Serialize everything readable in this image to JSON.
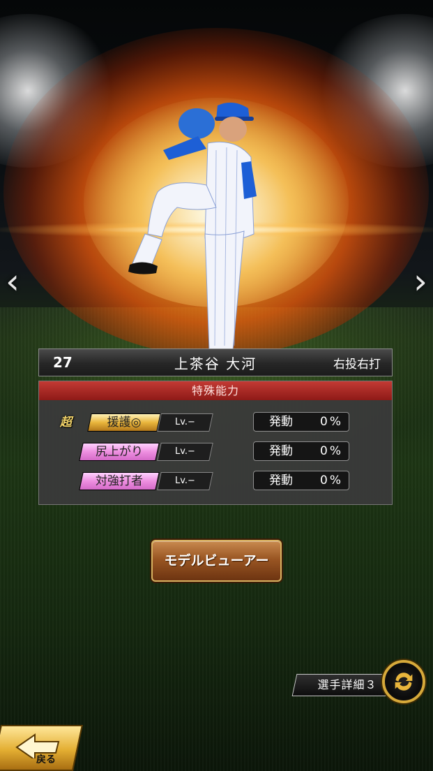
{
  "player": {
    "number": "27",
    "name": "上茶谷 大河",
    "position": "右投右打"
  },
  "abilities": {
    "header": "特殊能力",
    "items": [
      {
        "prefix": "超",
        "name": "援護◎",
        "level": "Lv.−",
        "status_label": "発動",
        "status_value": "0%",
        "color": "#e9b63c"
      },
      {
        "prefix": "",
        "name": "尻上がり",
        "level": "Lv.−",
        "status_label": "発動",
        "status_value": "0%",
        "color": "#ee8fe0"
      },
      {
        "prefix": "",
        "name": "対強打者",
        "level": "Lv.−",
        "status_label": "発動",
        "status_value": "0%",
        "color": "#ee8fe0"
      }
    ]
  },
  "buttons": {
    "model_viewer": "モデルビューアー",
    "player_detail": "選手詳細３",
    "back": "戻る"
  },
  "nav": {
    "prev": "‹",
    "next": "›"
  },
  "icons": {
    "prev": "chevron-left-icon",
    "next": "chevron-right-icon",
    "swap": "swap-arrows-icon",
    "back": "back-arrow-icon"
  }
}
